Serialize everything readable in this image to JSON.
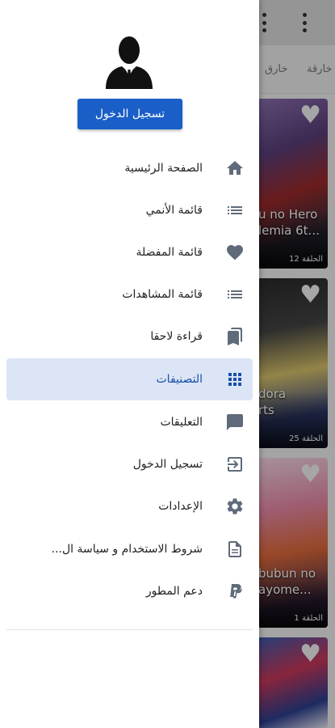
{
  "background": {
    "tabs": [
      "خارقة",
      "خارق"
    ],
    "cards": [
      {
        "title": "u no Hero",
        "subtitle": "lemia 6t...",
        "episode": "الحلقة 12"
      },
      {
        "title": "dora",
        "subtitle": "rts",
        "episode": "الحلقة 25"
      },
      {
        "title": "bubun no",
        "subtitle": "ayome...",
        "episode": "الحلقة 1"
      },
      {
        "title": "",
        "subtitle": "",
        "episode": ""
      }
    ]
  },
  "drawer": {
    "login_button": "تسجيل الدخول",
    "items": [
      {
        "label": "الصفحة الرئيسية",
        "icon": "home-icon"
      },
      {
        "label": "قائمة الأنمي",
        "icon": "list-icon"
      },
      {
        "label": "قائمة المفضلة",
        "icon": "heart-icon"
      },
      {
        "label": "قائمة المشاهدات",
        "icon": "list-icon"
      },
      {
        "label": "قراءة لاحقا",
        "icon": "bookmark-icon"
      },
      {
        "label": "التصنيفات",
        "icon": "grid-icon",
        "active": true
      },
      {
        "label": "التعليقات",
        "icon": "comment-icon"
      },
      {
        "label": "تسجيل الدخول",
        "icon": "login-icon"
      },
      {
        "label": "الإعدادات",
        "icon": "settings-icon"
      },
      {
        "label": "شروط الاستخدام و سياسة ال...",
        "icon": "document-icon"
      },
      {
        "label": "دعم المطور",
        "icon": "paypal-icon"
      }
    ]
  },
  "colors": {
    "accent": "#1a5fc8",
    "active_bg": "#dbe5f6",
    "icon_gray": "#5f6b7a",
    "active_icon": "#1a4fa8"
  }
}
